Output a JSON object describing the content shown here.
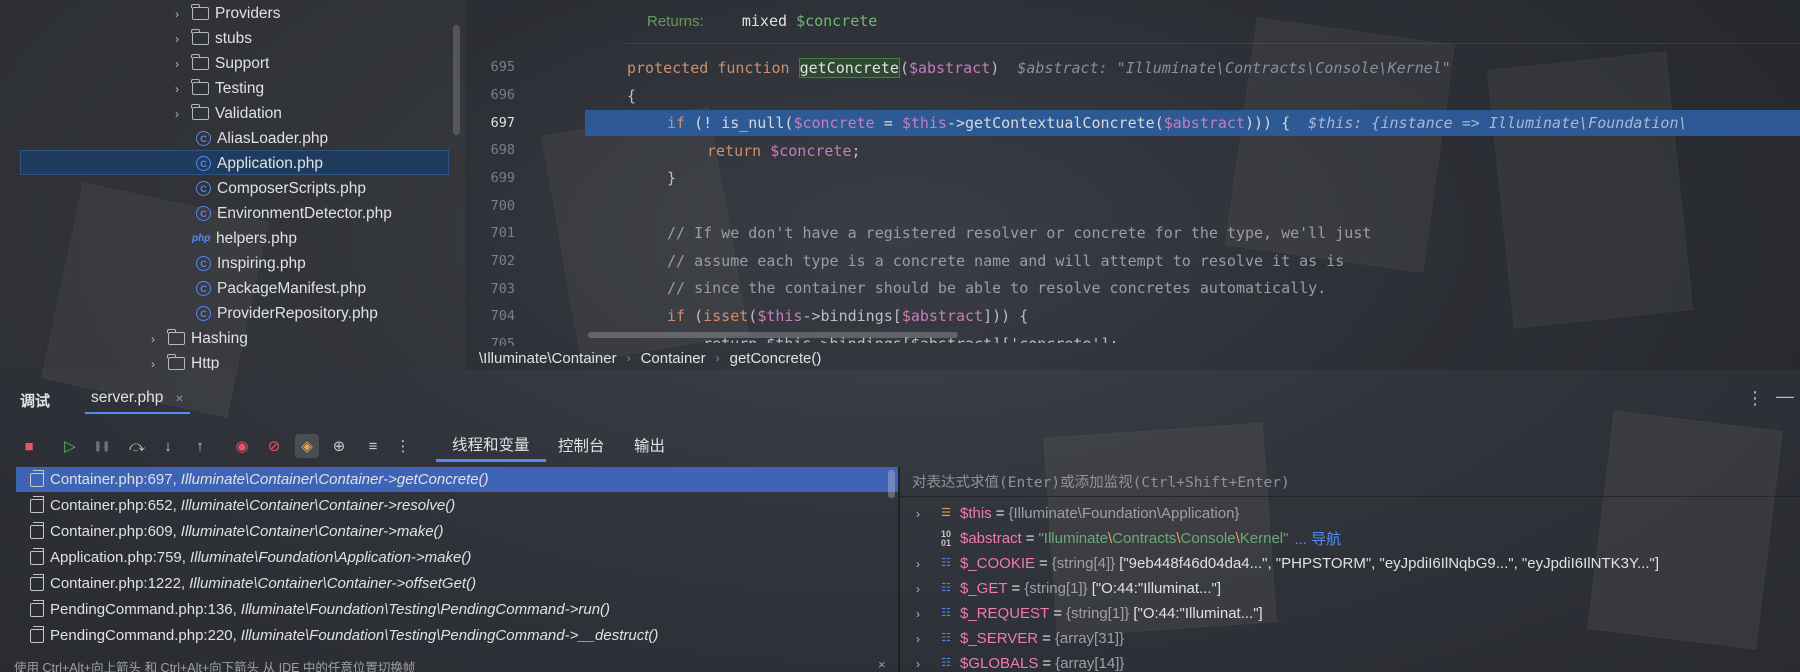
{
  "tree": {
    "rows": [
      {
        "label": "Providers",
        "kind": "folder",
        "chev": "›"
      },
      {
        "label": "stubs",
        "kind": "folder",
        "chev": "›"
      },
      {
        "label": "Support",
        "kind": "folder",
        "chev": "›"
      },
      {
        "label": "Testing",
        "kind": "folder",
        "chev": "›"
      },
      {
        "label": "Validation",
        "kind": "folder",
        "chev": "›"
      },
      {
        "label": "AliasLoader.php",
        "kind": "class"
      },
      {
        "label": "Application.php",
        "kind": "class",
        "selected": true
      },
      {
        "label": "ComposerScripts.php",
        "kind": "class"
      },
      {
        "label": "EnvironmentDetector.php",
        "kind": "class"
      },
      {
        "label": "helpers.php",
        "kind": "php"
      },
      {
        "label": "Inspiring.php",
        "kind": "class"
      },
      {
        "label": "PackageManifest.php",
        "kind": "class"
      },
      {
        "label": "ProviderRepository.php",
        "kind": "class"
      },
      {
        "label": "Hashing",
        "kind": "folder",
        "chev": "›"
      },
      {
        "label": "Http",
        "kind": "folder",
        "chev": "›"
      }
    ],
    "php_badge": "php"
  },
  "editor": {
    "doc_returns_label": "Returns:",
    "doc_returns_type": "mixed",
    "doc_returns_var": "$concrete",
    "line_numbers": [
      "695",
      "696",
      "697",
      "698",
      "699",
      "700",
      "701",
      "702",
      "703",
      "704",
      "705"
    ],
    "l695_kw1": "protected",
    "l695_kw2": "function",
    "l695_fn": "getConcrete",
    "l695_paren_open": "(",
    "l695_var": "$abstract",
    "l695_paren_close": ")",
    "l695_hint": "$abstract: \"Illuminate\\Contracts\\Console\\Kernel\"",
    "l696": "{",
    "l697_kw": "if",
    "l697_a": "(! ",
    "l697_fn": "is_null",
    "l697_b": "(",
    "l697_v1": "$concrete",
    "l697_c": " = ",
    "l697_v2": "$this",
    "l697_d": "->",
    "l697_m": "getContextualConcrete",
    "l697_e": "(",
    "l697_v3": "$abstract",
    "l697_f": "))) {",
    "l697_hint": "$this: {instance => Illuminate\\Foundation\\",
    "l698_kw": "return",
    "l698_v": "$concrete",
    "l698_end": ";",
    "l699": "}",
    "l701": "// If we don't have a registered resolver or concrete for the type, we'll just",
    "l702": "// assume each type is a concrete name and will attempt to resolve it as is",
    "l703": "// since the container should be able to resolve concretes automatically.",
    "l704_kw": "if",
    "l704_a": " (",
    "l704_fn": "isset",
    "l704_b": "(",
    "l704_v1": "$this",
    "l704_c": "->bindings[",
    "l704_v2": "$abstract",
    "l704_d": "])) {",
    "l705": "    return $this->bindings[$abstract]['concrete'];"
  },
  "breadcrumbs": [
    "\\Illuminate\\Container",
    "Container",
    "getConcrete()"
  ],
  "breadcrumb_sep": "›",
  "debug": {
    "title": "调试",
    "file_tab": "server.php",
    "file_tab_close": "×",
    "more": "⋮",
    "minimize": "—",
    "tabs": [
      "线程和变量",
      "控制台",
      "输出"
    ],
    "toolbar_glyphs": {
      "stop": "■",
      "resume": "▷",
      "pause": "❚❚",
      "step_over": "⤼",
      "step_into": "↓",
      "step_out": "↑",
      "breakpoints": "◉",
      "mute": "⊘",
      "active": "◈",
      "eval": "⊕",
      "add": "≡",
      "more": "⋮"
    },
    "frames": [
      {
        "loc": "Container.php:697,",
        "meth": "Illuminate\\Container\\Container->getConcrete()"
      },
      {
        "loc": "Container.php:652,",
        "meth": "Illuminate\\Container\\Container->resolve()"
      },
      {
        "loc": "Container.php:609,",
        "meth": "Illuminate\\Container\\Container->make()"
      },
      {
        "loc": "Application.php:759,",
        "meth": "Illuminate\\Foundation\\Application->make()"
      },
      {
        "loc": "Container.php:1222,",
        "meth": "Illuminate\\Container\\Container->offsetGet()"
      },
      {
        "loc": "PendingCommand.php:136,",
        "meth": "Illuminate\\Foundation\\Testing\\PendingCommand->run()"
      },
      {
        "loc": "PendingCommand.php:220,",
        "meth": "Illuminate\\Foundation\\Testing\\PendingCommand->__destruct()"
      }
    ],
    "watch_placeholder": "对表达式求值(Enter)或添加监视(Ctrl+Shift+Enter)",
    "vars": [
      {
        "name": "$this",
        "type": "{Illuminate\\Foundation\\Application}",
        "value": "",
        "icon": "obj"
      },
      {
        "name": "$abstract",
        "type": "",
        "value": "",
        "icon": "num",
        "nav": "... 导航"
      },
      {
        "name": "$_COOKIE",
        "type": "{string[4]}",
        "value": "[\"9eb448f46d04da4...\", \"PHPSTORM\", \"eyJpdiI6IlNqbG9...\", \"eyJpdiI6IlNTK3Y...\"]",
        "icon": "arr"
      },
      {
        "name": "$_GET",
        "type": "{string[1]}",
        "value": "[\"O:44:\"Illuminat...\"]",
        "icon": "arr"
      },
      {
        "name": "$_REQUEST",
        "type": "{string[1]}",
        "value": "[\"O:44:\"Illuminat...\"]",
        "icon": "arr"
      },
      {
        "name": "$_SERVER",
        "type": "{array[31]}",
        "value": "",
        "icon": "arr"
      },
      {
        "name": "$GLOBALS",
        "type": "{array[14]}",
        "value": "",
        "icon": "arr"
      }
    ],
    "abstract_str": {
      "q1": "\"",
      "p1": "Illuminate",
      "s1": "\\",
      "p2": "Contracts",
      "s2": "\\",
      "p3": "Console",
      "s3": "\\",
      "p4": "Kernel",
      "q2": "\""
    },
    "equals": "=",
    "chevron": "›",
    "status_text": "使用 Ctrl+Alt+向上箭头 和 Ctrl+Alt+向下箭头 从 IDE 中的任意位置切换帧",
    "status_close": "×"
  },
  "colors": {
    "accent": "#548af7",
    "selection": "#3f64b5",
    "keyword": "#cf8e6d",
    "variable": "#c77dbb",
    "string": "#6aab73",
    "stop": "#e55765"
  }
}
